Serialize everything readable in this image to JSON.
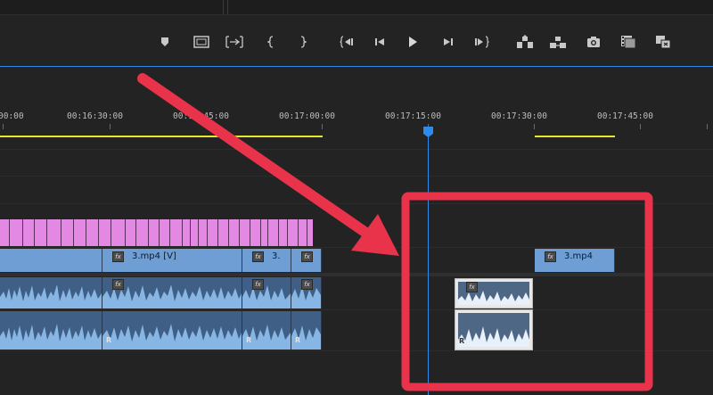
{
  "timeline": {
    "timecodes": [
      "00:00",
      "00:16:30:00",
      "00:16:45:00",
      "00:17:00:00",
      "00:17:15:00",
      "00:17:30:00",
      "00:17:45:00"
    ],
    "playhead_time": "00:17:15:00",
    "in_point_marker": "playhead-marker"
  },
  "transport": {
    "buttons": [
      "marker",
      "safe-margins",
      "insert-edit",
      "mark-in",
      "mark-out",
      "go-to-in",
      "step-back",
      "play",
      "step-forward",
      "go-to-out",
      "lift",
      "extract",
      "export-frame",
      "button-editor",
      "comparison-view"
    ]
  },
  "clips": {
    "video_main_label": "3.mp4 [V]",
    "video_short_label": "3.",
    "video_right_label": "3.mp4",
    "fx_label": "fx",
    "audio_right_channel": "R"
  },
  "colors": {
    "video_clip": "#6f9ed4",
    "audio_clip": "#3f5f86",
    "pink_clip": "#e389e3",
    "selection_box": "#e8334a",
    "playhead": "#2d8ceb",
    "work_area": "#e6e62a"
  }
}
